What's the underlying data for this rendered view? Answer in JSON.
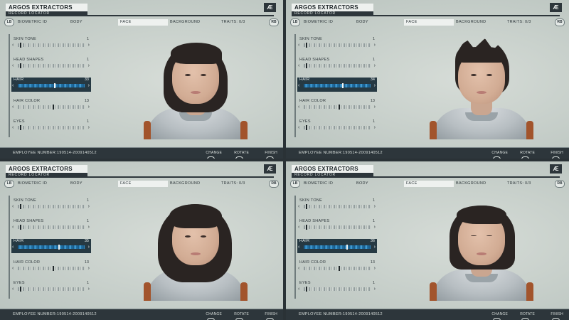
{
  "header": {
    "company": "ARGOS EXTRACTORS",
    "subtitle": "RECORD LOCATOR",
    "logo": "Æ"
  },
  "tabs": {
    "lb": "LB",
    "rb": "RB",
    "items": [
      "BIOMETRIC ID",
      "BODY",
      "FACE",
      "BACKGROUND",
      "TRAITS: 0/3"
    ],
    "active": "FACE"
  },
  "sliders": [
    {
      "label": "SKIN TONE",
      "value": "1"
    },
    {
      "label": "HEAD SHAPES",
      "value": "1"
    },
    {
      "label": "HAIR",
      "value": "33"
    },
    {
      "label": "HAIR COLOR",
      "value": "13"
    },
    {
      "label": "EYES",
      "value": "1"
    }
  ],
  "panels": [
    {
      "hair_value": "33",
      "hairstyle": "medium-shag"
    },
    {
      "hair_value": "34",
      "hairstyle": "spiky-updo"
    },
    {
      "hair_value": "35",
      "hairstyle": "long-wavy"
    },
    {
      "hair_value": "36",
      "hairstyle": "bob-closed-eyes"
    }
  ],
  "footer": {
    "employee_label": "EMPLOYEE NUMBER:",
    "employee_number": "190514-2009140512",
    "actions": [
      {
        "label": "CHANGE",
        "key": "◄►"
      },
      {
        "label": "ROTATE",
        "key": "RS"
      },
      {
        "label": "FINISH",
        "key": "X"
      }
    ]
  },
  "colors": {
    "panel_bg": "#c9d1cc",
    "dark": "#2d363b",
    "selected_row": "#263943",
    "slider_blue": "#2f86bf"
  },
  "icons": {
    "lb": "lb-button-icon",
    "rb": "rb-button-icon",
    "logo": "ae-logo-icon"
  }
}
